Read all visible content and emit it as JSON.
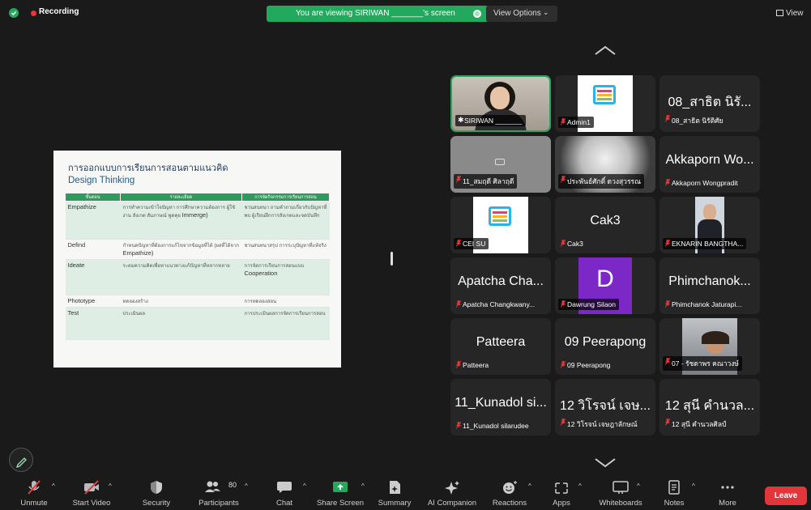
{
  "topbar": {
    "recording_label": "Recording",
    "banner_text": "You are viewing SIRIWAN _______'s screen",
    "view_options_label": "View Options",
    "view_label": "View"
  },
  "slide": {
    "title": "การออกแบบการเรียนการสอนตามแนวคิด",
    "subtitle": "Design Thinking",
    "columns": [
      "ขั้นตอน",
      "รายละเอียด",
      "การจัดกิจกรรมการเรียนการสอน"
    ],
    "rows": [
      {
        "stage": "Empathize",
        "desc": "การทำความเข้าใจปัญหา การศึกษาความต้องการ ผู้ใช้งาน สังเกต สัมภาษณ์ พูดคุย",
        "desc_em": "Immerge)",
        "act": "ชวนสนทนา ถามคำถามเกี่ยวกับปัญหาที่พบ ผู้เรียนฝึกการสังเกตและจดบันทึก",
        "act_em": ""
      },
      {
        "stage": "Defind",
        "desc": "กำหนดปัญหาที่ต้องการแก้ไขจากข้อมูลที่ได้ (ผลที่ได้จาก",
        "desc_em": "Empathize)",
        "act": "ชวนสนทนาสรุป การระบุปัญหาที่แท้จริง",
        "act_em": ""
      },
      {
        "stage": "Ideate",
        "desc": "ระดมความคิดเพื่อหาแนวทางแก้ปัญหาที่หลากหลาย",
        "desc_em": "",
        "act": "การจัดการเรียนการสอนแบบ",
        "act_em": "Cooperation"
      },
      {
        "stage": "Phototype",
        "desc": "ทดลองสร้าง",
        "desc_em": "",
        "act": "การทดลองสอน",
        "act_em": ""
      },
      {
        "stage": "Test",
        "desc": "ประเมินผล",
        "desc_em": "",
        "act": "การประเมินผลการจัดการเรียนการสอน",
        "act_em": ""
      }
    ]
  },
  "gallery": [
    {
      "name": "",
      "label": "SIRIWAN _______",
      "photo": "woman-webcam"
    },
    {
      "name": "",
      "label": "Admin1",
      "photo": "cei-logo"
    },
    {
      "name": "08_สาธิต นิรั...",
      "label": "08_สาธิต นิรัติศัย",
      "photo": ""
    },
    {
      "name": "",
      "label": "11_สมฤดี ศิลาฤดี",
      "photo": "camera-off-grey"
    },
    {
      "name": "",
      "label": "ประพันธ์ศักดิ์ ดวงสุวรรณ",
      "photo": "profile-photo"
    },
    {
      "name": "Akkaporn Wo...",
      "label": "Akkaporn Wongpradit",
      "photo": ""
    },
    {
      "name": "",
      "label": "CEI SU",
      "photo": "cei-logo"
    },
    {
      "name": "Cak3",
      "label": "Cak3",
      "photo": ""
    },
    {
      "name": "",
      "label": "EKNARIN BANGTHA...",
      "photo": "man-portrait"
    },
    {
      "name": "Apatcha Cha...",
      "label": "Apatcha Changkwany...",
      "photo": ""
    },
    {
      "name": "D",
      "label": "Dawrung Silaon",
      "photo": "avatar-letter"
    },
    {
      "name": "Phimchanok...",
      "label": "Phimchanok Jaturapi...",
      "photo": ""
    },
    {
      "name": "Patteera",
      "label": "Patteera",
      "photo": ""
    },
    {
      "name": "09 Peerapong",
      "label": "09 Peerapong",
      "photo": ""
    },
    {
      "name": "",
      "label": "07 - รัชดาพร คณาวงษ์",
      "photo": "woman-selfie"
    },
    {
      "name": "11_Kunadol si...",
      "label": "11_Kunadol silarudee",
      "photo": ""
    },
    {
      "name": "12 วิโรจน์ เจษ...",
      "label": "12 วิโรจน์ เจษฎาลักษณ์",
      "photo": ""
    },
    {
      "name": "12 สุนี คำนวล...",
      "label": "12 สุนี คำนวลศิลป์",
      "photo": ""
    }
  ],
  "toolbar": {
    "unmute": "Unmute",
    "start_video": "Start Video",
    "security": "Security",
    "participants": "Participants",
    "participants_count": "80",
    "chat": "Chat",
    "share_screen": "Share Screen",
    "summary": "Summary",
    "ai_companion": "AI Companion",
    "reactions": "Reactions",
    "apps": "Apps",
    "whiteboards": "Whiteboards",
    "notes": "Notes",
    "more": "More",
    "leave": "Leave"
  },
  "colors": {
    "accent_green": "#23a95d",
    "leave_red": "#e3363a",
    "muted_red": "#e8373a",
    "avatar_purple": "#7b28c7"
  }
}
